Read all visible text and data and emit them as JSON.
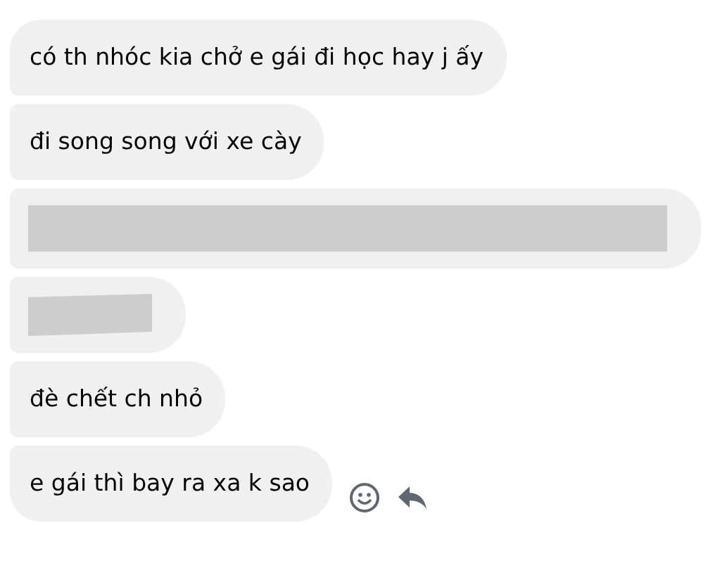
{
  "messages": [
    {
      "kind": "text",
      "text": "có th nhóc kia chở e gái đi học hay j ấy"
    },
    {
      "kind": "text",
      "text": "đi song song với xe cày"
    },
    {
      "kind": "redacted"
    },
    {
      "kind": "stub"
    },
    {
      "kind": "text",
      "text": "đè chết ch nhỏ"
    },
    {
      "kind": "text",
      "text": "e gái thì bay ra xa k sao",
      "actions": true
    }
  ]
}
